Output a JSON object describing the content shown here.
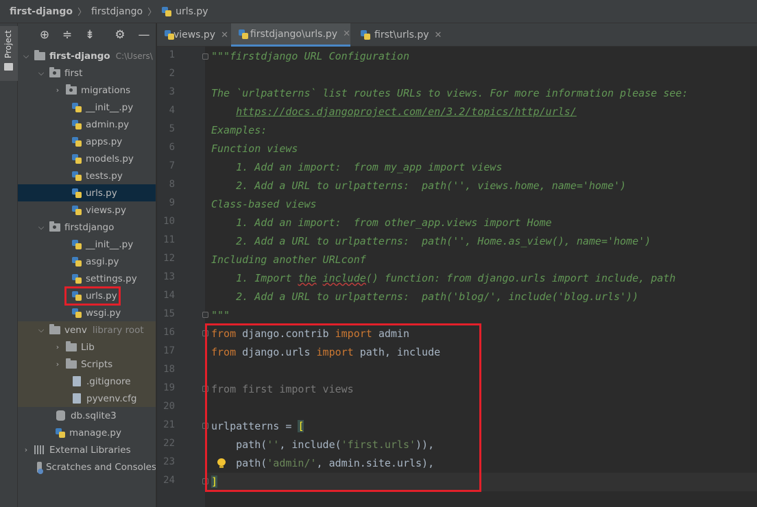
{
  "breadcrumb": {
    "project": "first-django",
    "folder": "firstdjango",
    "file": "urls.py"
  },
  "tool_strip": {
    "project_tab": "Project"
  },
  "project_panel": {
    "toolbar_icons": [
      "locate-icon",
      "expand-all-icon",
      "collapse-all-icon",
      "gear-icon",
      "minimize-icon"
    ],
    "root": {
      "name": "first-django",
      "path": "C:\\Users\\"
    },
    "first": {
      "name": "first",
      "migrations": "migrations",
      "files": [
        "__init__.py",
        "admin.py",
        "apps.py",
        "models.py",
        "tests.py",
        "urls.py",
        "views.py"
      ]
    },
    "firstdjango": {
      "name": "firstdjango",
      "files": [
        "__init__.py",
        "asgi.py",
        "settings.py",
        "urls.py",
        "wsgi.py"
      ]
    },
    "venv": {
      "name": "venv",
      "tag": "library root",
      "lib": "Lib",
      "scripts": "Scripts",
      "gitignore": ".gitignore",
      "pyvenv": "pyvenv.cfg"
    },
    "db": "db.sqlite3",
    "manage": "manage.py",
    "external_libraries": "External Libraries",
    "scratches": "Scratches and Consoles"
  },
  "tabs": [
    {
      "label": "views.py"
    },
    {
      "label": "firstdjango\\urls.py"
    },
    {
      "label": "first\\urls.py"
    }
  ],
  "line_numbers": [
    "1",
    "2",
    "3",
    "4",
    "5",
    "6",
    "7",
    "8",
    "9",
    "10",
    "11",
    "12",
    "13",
    "14",
    "15",
    "16",
    "17",
    "18",
    "19",
    "20",
    "21",
    "22",
    "23",
    "24"
  ],
  "code": {
    "l1": "\"\"\"firstdjango URL Configuration",
    "l3": "The `urlpatterns` list routes URLs to views. For more information please see:",
    "l4_indent": "    ",
    "l4_link": "https://docs.djangoproject.com/en/3.2/topics/http/urls/",
    "l5": "Examples:",
    "l6": "Function views",
    "l7": "    1. Add an import:  from my_app import views",
    "l8": "    2. Add a URL to urlpatterns:  path('', views.home, name='home')",
    "l9": "Class-based views",
    "l10": "    1. Add an import:  from other_app.views import Home",
    "l11": "    2. Add a URL to urlpatterns:  path('', Home.as_view(), name='home')",
    "l12": "Including another URLconf",
    "l13_a": "    1. Import ",
    "l13_b": "the",
    "l13_c": " ",
    "l13_d": "include",
    "l13_e": "() function: from django.urls import include, path",
    "l14": "    2. Add a URL to urlpatterns:  path('blog/', include('blog.urls'))",
    "l15": "\"\"\"",
    "l16_kw1": "from",
    "l16_mod": " django.contrib ",
    "l16_kw2": "import",
    "l16_name": " admin",
    "l17_kw1": "from",
    "l17_mod": " django.urls ",
    "l17_kw2": "import",
    "l17_name": " path, include",
    "l19": "from first import views",
    "l21_name": "urlpatterns = ",
    "l21_bracket": "[",
    "l22_a": "    path(",
    "l22_s1": "''",
    "l22_b": ", include(",
    "l22_s2": "'first.urls'",
    "l22_c": ")),",
    "l23_a": "    path(",
    "l23_s1": "'admin/'",
    "l23_b": ", admin.site.urls),",
    "l24_bracket": "]"
  }
}
